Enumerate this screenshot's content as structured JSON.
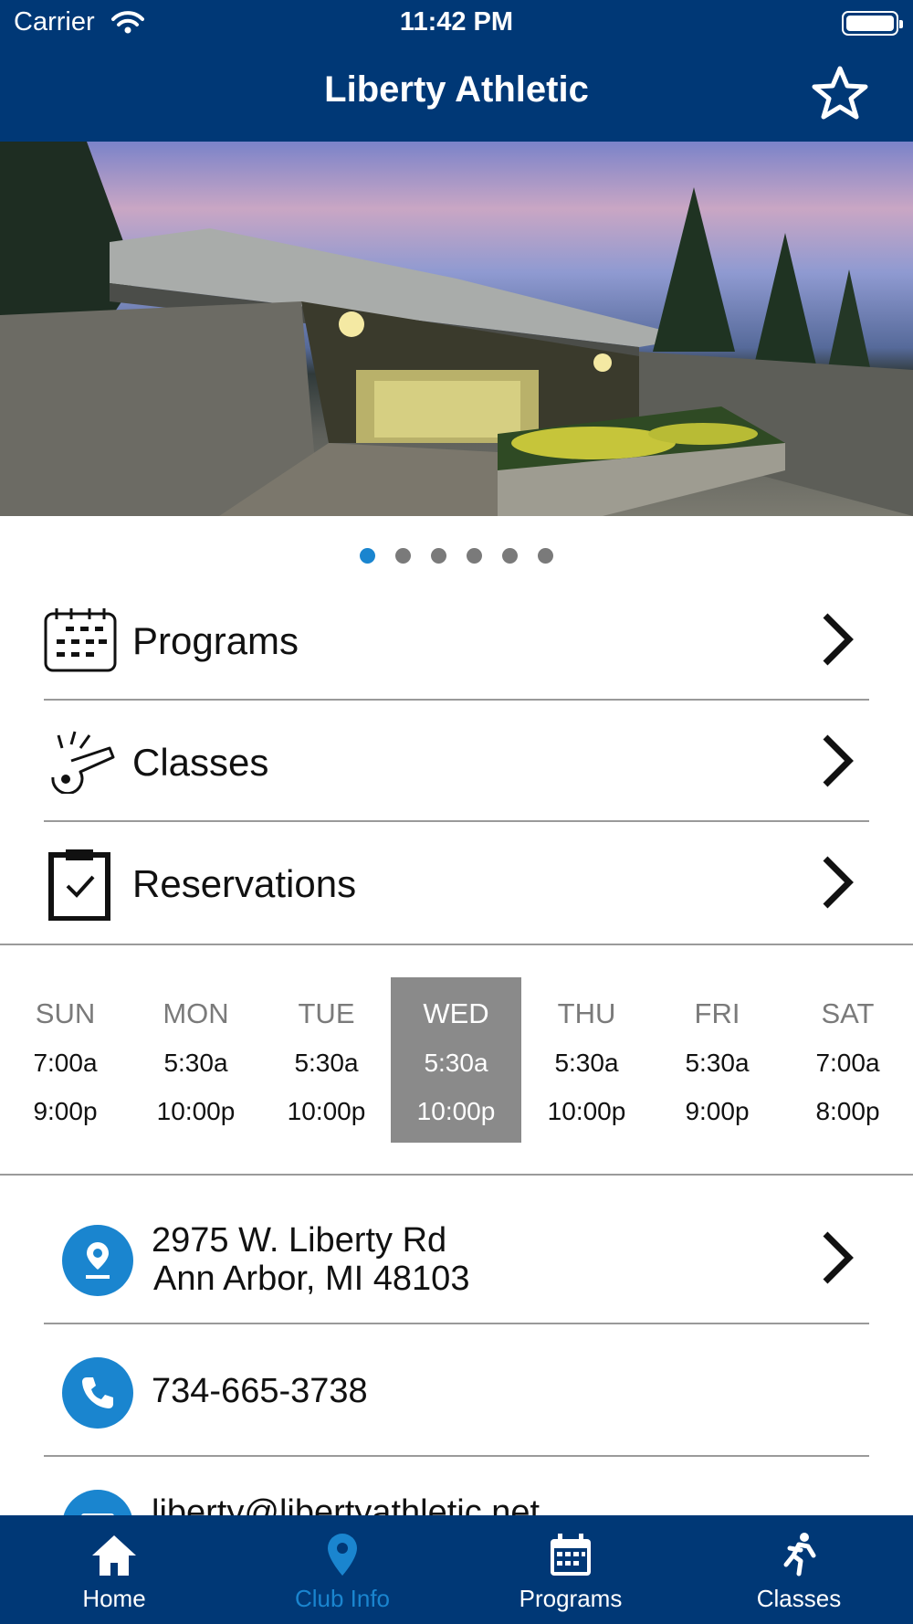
{
  "status_bar": {
    "carrier": "Carrier",
    "time": "11:42 PM"
  },
  "header": {
    "title": "Liberty Athletic",
    "favorite_icon": "star-outline-icon"
  },
  "carousel": {
    "page_count": 6,
    "active_index": 0
  },
  "menu": [
    {
      "label": "Programs",
      "icon": "calendar-icon"
    },
    {
      "label": "Classes",
      "icon": "whistle-icon"
    },
    {
      "label": "Reservations",
      "icon": "clipboard-check-icon"
    }
  ],
  "hours": [
    {
      "day": "SUN",
      "open": "7:00a",
      "close": "9:00p"
    },
    {
      "day": "MON",
      "open": "5:30a",
      "close": "10:00p"
    },
    {
      "day": "TUE",
      "open": "5:30a",
      "close": "10:00p"
    },
    {
      "day": "WED",
      "open": "5:30a",
      "close": "10:00p",
      "today": true
    },
    {
      "day": "THU",
      "open": "5:30a",
      "close": "10:00p"
    },
    {
      "day": "FRI",
      "open": "5:30a",
      "close": "9:00p"
    },
    {
      "day": "SAT",
      "open": "7:00a",
      "close": "8:00p"
    }
  ],
  "contact": {
    "address_line1": "2975 W. Liberty Rd",
    "address_line2": "Ann Arbor, MI 48103",
    "phone": "734-665-3738",
    "email_partial": "liberty@libertyathletic.net"
  },
  "tabs": [
    {
      "label": "Home",
      "icon": "home-icon"
    },
    {
      "label": "Club Info",
      "icon": "location-pin-icon",
      "selected": true
    },
    {
      "label": "Programs",
      "icon": "calendar-icon"
    },
    {
      "label": "Classes",
      "icon": "runner-icon"
    }
  ],
  "colors": {
    "navy": "#003876",
    "accent_blue": "#1a85cf",
    "today_gray": "#8a8a8a"
  }
}
